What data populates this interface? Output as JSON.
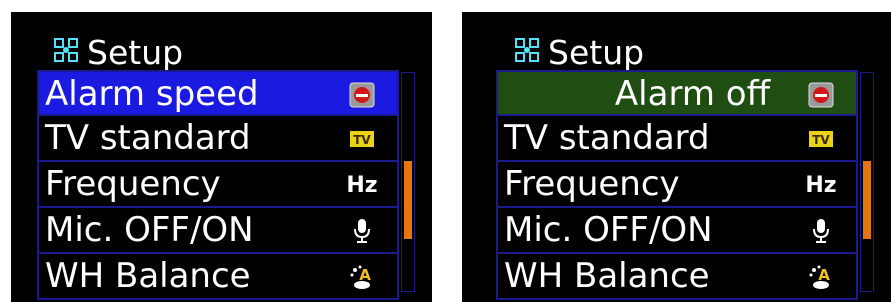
{
  "left_panel": {
    "title": "Setup",
    "title_icon": "setup-grid-icon",
    "items": [
      {
        "label": "Alarm speed",
        "icon": "alarm-icon",
        "state": "selected"
      },
      {
        "label": "TV standard",
        "icon": "tv-standard-icon"
      },
      {
        "label": "Frequency",
        "icon": "hz-icon",
        "icon_text": "Hz"
      },
      {
        "label": "Mic. OFF/ON",
        "icon": "microphone-icon"
      },
      {
        "label": "WH Balance",
        "icon": "white-balance-icon"
      }
    ],
    "scroll_position": 0.4
  },
  "right_panel": {
    "title": "Setup",
    "title_icon": "setup-grid-icon",
    "items": [
      {
        "label": "Alarm off",
        "icon": "alarm-icon",
        "state": "editing"
      },
      {
        "label": "TV standard",
        "icon": "tv-standard-icon"
      },
      {
        "label": "Frequency",
        "icon": "hz-icon",
        "icon_text": "Hz"
      },
      {
        "label": "Mic. OFF/ON",
        "icon": "microphone-icon"
      },
      {
        "label": "WH Balance",
        "icon": "white-balance-icon"
      }
    ],
    "scroll_position": 0.4
  },
  "colors": {
    "selected_blue": "#1a1ae0",
    "editing_green": "#1f4d12",
    "scrollbar_thumb": "#e87410",
    "row_border": "#1a1a8a"
  }
}
